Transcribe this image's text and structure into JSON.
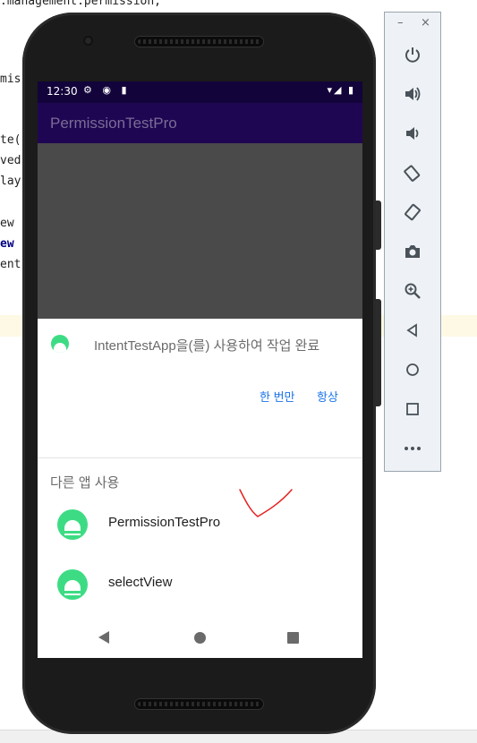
{
  "ide": {
    "code_fragments": [
      {
        "text": "mis",
        "class": "code"
      },
      {
        "text": "te(",
        "class": "code"
      },
      {
        "text": "ved",
        "class": "code"
      },
      {
        "text": "lay",
        "class": "code"
      },
      {
        "text": "ew",
        "class": "code"
      },
      {
        "text": "ew",
        "class": "code kw"
      },
      {
        "text": "ent",
        "class": "code"
      }
    ]
  },
  "phone": {
    "status_time": "12:30",
    "status_left_icons": "⚙ ◉ ▮",
    "status_right_icons": "▾◢ ▮",
    "app_title": "PermissionTestPro",
    "chooser": {
      "title": "IntentTestApp을(를) 사용하여 작업 완료",
      "just_once": "한 번만",
      "always": "항상",
      "other_apps_label": "다른 앱 사용",
      "apps": [
        {
          "name": "PermissionTestPro"
        },
        {
          "name": "selectView"
        }
      ]
    }
  },
  "toolbar": {
    "minimize": "–",
    "close": "×",
    "buttons": [
      {
        "icon": "power-icon",
        "glyph": "⏻"
      },
      {
        "icon": "volume-up-icon",
        "glyph": "🔊"
      },
      {
        "icon": "volume-down-icon",
        "glyph": "🔉"
      },
      {
        "icon": "rotate-left-icon",
        "glyph": "⟲"
      },
      {
        "icon": "rotate-right-icon",
        "glyph": "⟳"
      },
      {
        "icon": "camera-icon",
        "glyph": "📷"
      },
      {
        "icon": "zoom-icon",
        "glyph": "⊕"
      },
      {
        "icon": "back-icon",
        "glyph": "◁"
      },
      {
        "icon": "home-icon",
        "glyph": "○"
      },
      {
        "icon": "overview-icon",
        "glyph": "□"
      },
      {
        "icon": "more-icon",
        "glyph": "•••"
      }
    ]
  },
  "colors": {
    "status_bar": "#12033b",
    "app_bar": "#1f0653",
    "accent": "#1a73e8",
    "android_green": "#3ddc84"
  }
}
